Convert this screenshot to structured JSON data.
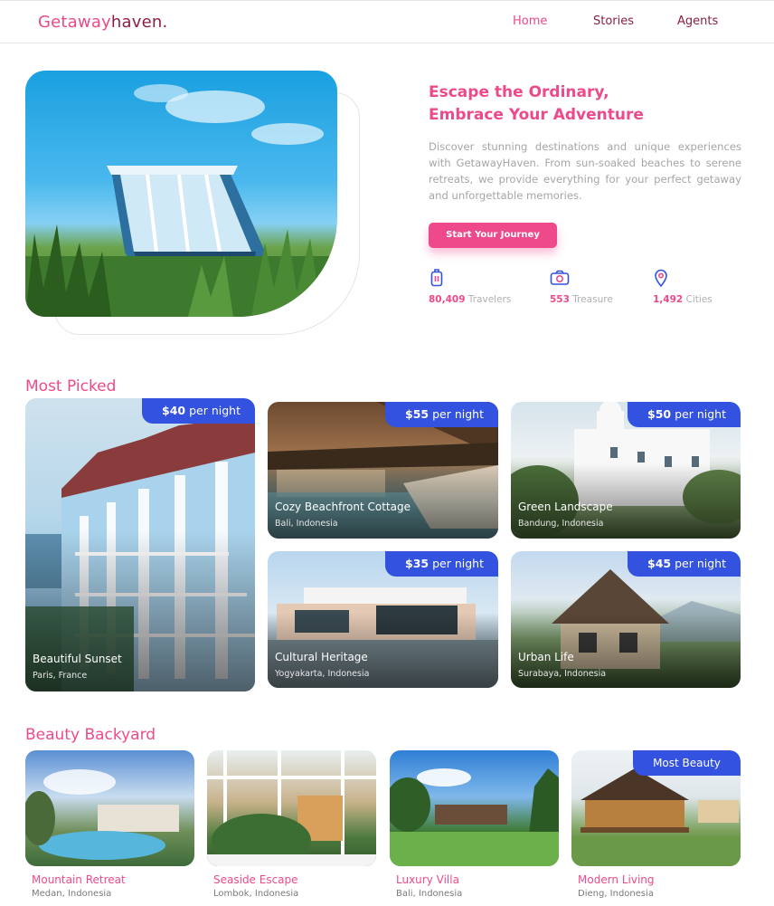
{
  "brand": {
    "part1": "Getaway",
    "part2": "haven."
  },
  "nav": {
    "home": "Home",
    "stories": "Stories",
    "agents": "Agents"
  },
  "hero": {
    "title_line1": "Escape the Ordinary,",
    "title_line2": "Embrace Your Adventure",
    "description": "Discover stunning destinations and unique experiences with GetawayHaven. From sun-soaked beaches to serene retreats, we provide everything for your perfect getaway and unforgettable memories.",
    "cta": "Start Your Journey",
    "stats": [
      {
        "icon": "luggage-icon",
        "value": "80,409",
        "label": "Travelers"
      },
      {
        "icon": "camera-icon",
        "value": "553",
        "label": "Treasure"
      },
      {
        "icon": "map-pin-icon",
        "value": "1,492",
        "label": "Cities"
      }
    ]
  },
  "most_picked": {
    "title": "Most Picked",
    "items": [
      {
        "price": "$40",
        "unit": "per night",
        "name": "Beautiful Sunset",
        "location": "Paris, France"
      },
      {
        "price": "$55",
        "unit": "per night",
        "name": "Cozy Beachfront Cottage",
        "location": "Bali, Indonesia"
      },
      {
        "price": "$50",
        "unit": "per night",
        "name": "Green Landscape",
        "location": "Bandung, Indonesia"
      },
      {
        "price": "$35",
        "unit": "per night",
        "name": "Cultural Heritage",
        "location": "Yogyakarta, Indonesia"
      },
      {
        "price": "$45",
        "unit": "per night",
        "name": "Urban Life",
        "location": "Surabaya, Indonesia"
      }
    ]
  },
  "beauty_backyard": {
    "title": "Beauty Backyard",
    "items": [
      {
        "name": "Mountain Retreat",
        "location": "Medan, Indonesia",
        "badge": ""
      },
      {
        "name": "Seaside Escape",
        "location": "Lombok, Indonesia",
        "badge": ""
      },
      {
        "name": "Luxury Villa",
        "location": "Bali, Indonesia",
        "badge": ""
      },
      {
        "name": "Modern Living",
        "location": "Dieng, Indonesia",
        "badge": "Most Beauty"
      }
    ]
  }
}
